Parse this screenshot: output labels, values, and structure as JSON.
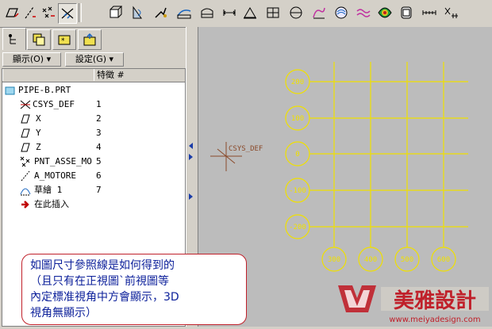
{
  "toolbar": {
    "icons": [
      "datum-plane-icon",
      "datum-axis-icon",
      "datum-point-icon",
      "csys-icon",
      "extrude-icon",
      "revolve-icon",
      "sweep-icon",
      "round-icon",
      "chamfer-icon",
      "draft-icon",
      "rib-icon",
      "shell-icon",
      "hole-icon",
      "pattern-icon",
      "mirror-icon",
      "surface-icon",
      "analysis-icon",
      "render-icon",
      "model-tree-icon",
      "dimension-icon",
      "dimension-pattern-icon"
    ]
  },
  "navigator": {
    "tabs": [
      "model-tree-tab",
      "layer-tab",
      "favorites-tab",
      "folder-tab"
    ],
    "show_menu": "顯示(O)",
    "settings_menu": "設定(G)",
    "header_feature": "特徵 #",
    "items": [
      {
        "label": "PIPE-B.PRT",
        "number": ""
      },
      {
        "label": "CSYS_DEF",
        "number": "1"
      },
      {
        "label": "X",
        "number": "2"
      },
      {
        "label": "Y",
        "number": "3"
      },
      {
        "label": "Z",
        "number": "4"
      },
      {
        "label": "PNT_ASSE_MO",
        "number": "5"
      },
      {
        "label": "A_MOTORE",
        "number": "6"
      },
      {
        "label": "草繪 1",
        "number": "7"
      },
      {
        "label": "在此插入",
        "number": ""
      }
    ]
  },
  "viewport": {
    "csys_label": "CSYS_DEF",
    "horizontal_refs": [
      "200",
      "100",
      "0",
      "-100",
      "-200"
    ],
    "vertical_refs": [
      "300",
      "400",
      "500",
      "600"
    ],
    "line_color": "#f0e000"
  },
  "callout": {
    "line1": "如圖尺寸參照線是如何得到的",
    "line2": "（且只有在正視圖`前視圖等",
    "line3": "內定標准視角中方會顯示，3D",
    "line4": "視角無顯示）",
    "text_color": "#0b1f9a",
    "border_color": "#c0202a"
  },
  "watermark": {
    "brand": "美雅設計",
    "url": "www.meiyadesign.com"
  }
}
